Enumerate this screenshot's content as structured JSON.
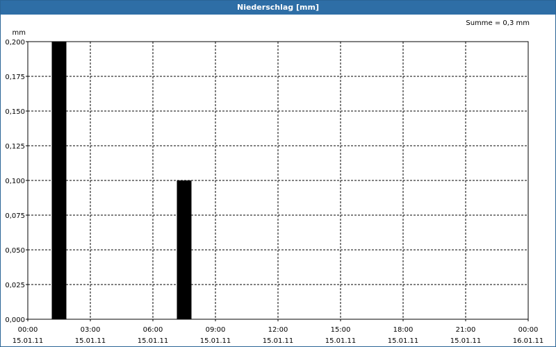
{
  "window": {
    "title": "Niederschlag [mm]"
  },
  "summary": "Summe = 0,3 mm",
  "chart_data": {
    "type": "bar",
    "title": "Niederschlag [mm]",
    "ylabel": "mm",
    "xlabel": "",
    "ylim": [
      0,
      0.2
    ],
    "xlim": [
      "15.01.11 00:00",
      "16.01.11 00:00"
    ],
    "grid": true,
    "y_ticks": [
      "0,000",
      "0,025",
      "0,050",
      "0,075",
      "0,100",
      "0,125",
      "0,150",
      "0,175",
      "0,200"
    ],
    "x_ticks": [
      {
        "time": "00:00",
        "date": "15.01.11"
      },
      {
        "time": "03:00",
        "date": "15.01.11"
      },
      {
        "time": "06:00",
        "date": "15.01.11"
      },
      {
        "time": "09:00",
        "date": "15.01.11"
      },
      {
        "time": "12:00",
        "date": "15.01.11"
      },
      {
        "time": "15:00",
        "date": "15.01.11"
      },
      {
        "time": "18:00",
        "date": "15.01.11"
      },
      {
        "time": "21:00",
        "date": "15.01.11"
      },
      {
        "time": "00:00",
        "date": "16.01.11"
      }
    ],
    "bars": [
      {
        "start": "15.01.11 01:00",
        "end": "15.01.11 02:00",
        "value": 0.2
      },
      {
        "start": "15.01.11 07:00",
        "end": "15.01.11 08:00",
        "value": 0.1
      }
    ],
    "colors": {
      "bar": "#000000",
      "grid": "#000000"
    }
  }
}
